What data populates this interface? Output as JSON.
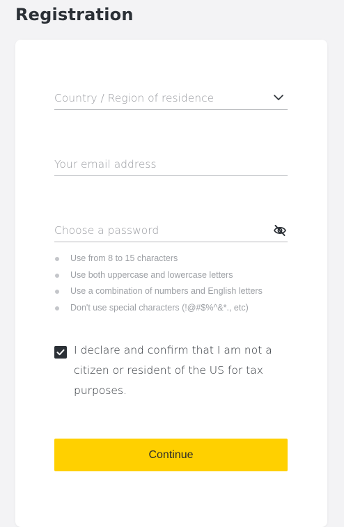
{
  "page": {
    "title": "Registration"
  },
  "form": {
    "country": {
      "placeholder": "Country / Region of residence",
      "icon": "chevron-down-icon"
    },
    "email": {
      "placeholder": "Your email address"
    },
    "password": {
      "placeholder": "Choose a password",
      "icon": "eye-off-icon"
    },
    "password_rules": [
      "Use from 8 to 15 characters",
      "Use both uppercase and lowercase letters",
      "Use a combination of numbers and English letters",
      "Don't use special characters (!@#$%^&*., etc)"
    ],
    "declaration": {
      "checked": true,
      "text": "I declare and confirm that I am not a citizen or resident of the US for tax purposes."
    },
    "continue_label": "Continue"
  },
  "colors": {
    "accent": "#ffd000",
    "text_dark": "#2b3036",
    "muted": "#9a9ca1",
    "background": "#f3f3f5"
  }
}
